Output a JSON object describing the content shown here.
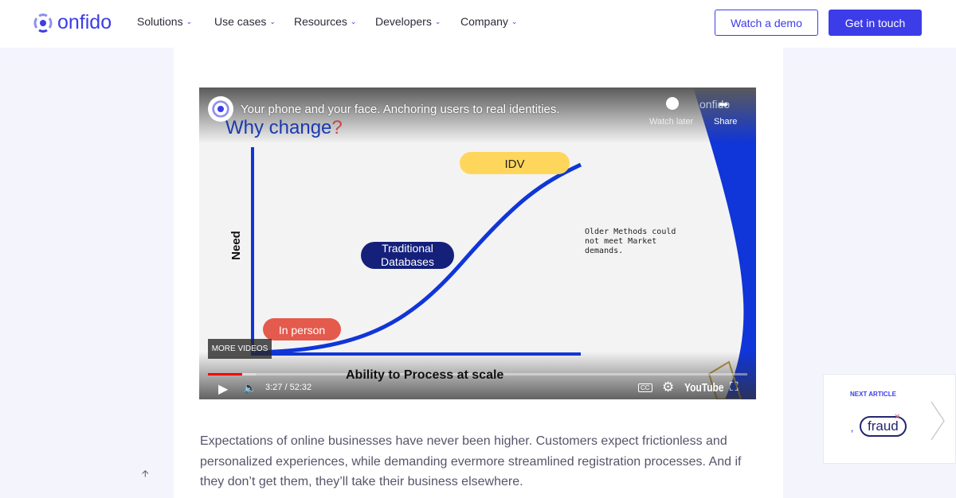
{
  "header": {
    "brand": "onfido",
    "nav": [
      {
        "label": "Solutions"
      },
      {
        "label": "Use cases"
      },
      {
        "label": "Resources"
      },
      {
        "label": "Developers"
      },
      {
        "label": "Company"
      }
    ],
    "watch_demo": "Watch a demo",
    "get_in_touch": "Get in touch",
    "accent": "#3c3ce8"
  },
  "video": {
    "title": "Your phone and your face. Anchoring users to real identities.",
    "watch_later": "Watch later",
    "share": "Share",
    "brand_watermark": "onfido",
    "more_videos": "MORE VIDEOS",
    "time": "3:27 / 52:32",
    "youtube": "YouTube",
    "progress_percent": 6.5,
    "slide": {
      "heading": "Why change",
      "heading_mark": "?",
      "y_label": "Need",
      "x_label": "Ability to Process at scale",
      "idv": "IDV",
      "traditional": [
        "Traditional",
        "Databases"
      ],
      "in_person": "In person",
      "note": [
        "Older Methods could",
        "not meet Market",
        "demands."
      ]
    }
  },
  "article": {
    "paragraph": "Expectations of online businesses have never been higher. Customers expect frictionless and personalized experiences, while demanding evermore streamlined registration processes. And if they don’t get them, they’ll take their business elsewhere."
  },
  "next_article": {
    "label": "NEXT ARTICLE",
    "thumb_text": "fraud"
  }
}
